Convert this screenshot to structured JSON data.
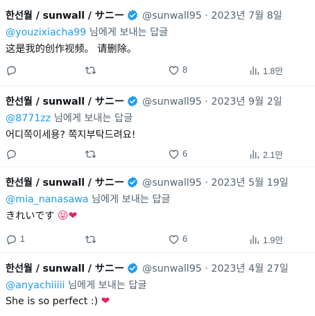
{
  "colors": {
    "accent": "#1d9bf0",
    "text": "#0f1419",
    "muted": "#536471",
    "heart": "#e0245e"
  },
  "tweets": [
    {
      "author": "한선월 / sunwall / サニー",
      "meta": "@sunwall95 · 2023년 7월 8일",
      "mention": "@youzixiacha99",
      "reply_suffix": " 님에게 보내는 답글",
      "text": "这是我的创作视频。 请删除。",
      "emoji": "",
      "replies": "",
      "likes": "8",
      "views": "1.8만"
    },
    {
      "author": "한선월 / sunwall / サニー",
      "meta": "@sunwall95 · 2023년 9월 2일",
      "mention": "@8771zz",
      "reply_suffix": " 님에게 보내는 답글",
      "text": "어디쪽이세용? 쪽지부탁드려요!",
      "emoji": "",
      "replies": "",
      "likes": "6",
      "views": "2.1만"
    },
    {
      "author": "한선월 / sunwall / サニー",
      "meta": "@sunwall95 · 2023년 5월 19일",
      "mention": "@mia_nanasawa",
      "reply_suffix": " 님에게 보내는 답글",
      "text": "きれいです ",
      "emoji": "😝❤",
      "replies": "1",
      "likes": "6",
      "views": "1.9만"
    },
    {
      "author": "한선월 / sunwall / サニー",
      "meta": "@sunwall95 · 2023년 4월 27일",
      "mention": "@anyachiiiii",
      "reply_suffix": " 님에게 보내는 답글",
      "text": "She is so perfect :) ",
      "emoji": "❤",
      "replies": "",
      "likes": "",
      "views": ""
    }
  ]
}
